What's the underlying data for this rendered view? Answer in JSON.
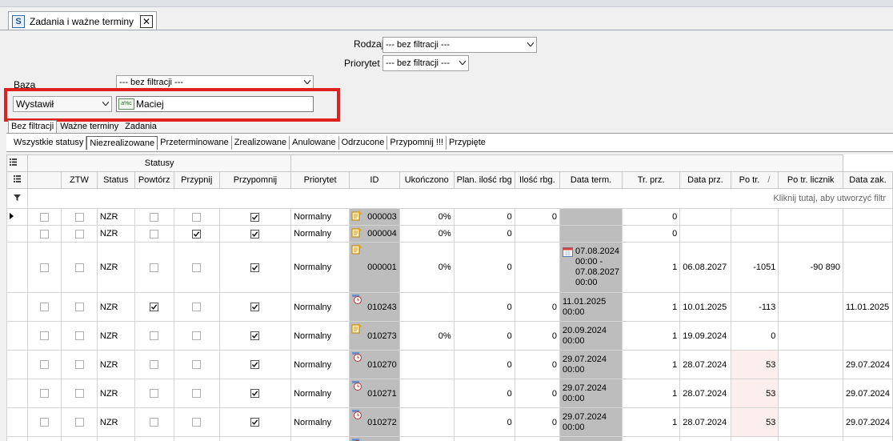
{
  "window": {
    "tab_title": "Zadania i ważne terminy",
    "close_label": "✕",
    "app_icon": "S"
  },
  "filters": {
    "rodzaj_label": "Rodzaj",
    "rodzaj_value": "--- bez filtracji ---",
    "priorytet_label": "Priorytet",
    "priorytet_value": "--- bez filtracji ---",
    "baza_label": "Baza",
    "baza_value": "--- bez filtracji ---",
    "field_select_value": "Wystawił",
    "field_input_icon": "a%c",
    "field_input_value": "Maciej"
  },
  "tabs_top": [
    "Bez filtracji",
    "Ważne terminy",
    "Zadania"
  ],
  "tabs_status": [
    "Wszystkie statusy",
    "Niezrealizowane",
    "Przeterminowane",
    "Zrealizowane",
    "Anulowane",
    "Odrzucone",
    "Przypomnij !!!",
    "Przypięte"
  ],
  "grid": {
    "group_label": "Statusy",
    "filter_hint": "Kliknij tutaj, aby utworzyć filtr",
    "sort_indicator": "/",
    "columns": [
      "ZTW",
      "Status",
      "Powtórz",
      "Przypnij",
      "Przypomnij",
      "Priorytet",
      "ID",
      "Ukończono",
      "Plan. ilość rbg",
      "Ilość rbg.",
      "Data term.",
      "Tr. prz.",
      "Data prz.",
      "Po tr.",
      "Po tr. licznik",
      "Data zak."
    ],
    "rows": [
      {
        "icon": "note",
        "selected": true,
        "ztw": false,
        "status": "NZR",
        "powtorz": false,
        "przypnij": false,
        "przypomnij": true,
        "priorytet": "Normalny",
        "id": "000003",
        "ukonczono": "0%",
        "plan": "0",
        "ilosc": "0",
        "data_term": "",
        "tr_prz": "0",
        "data_prz": "",
        "po_tr": "",
        "po_tr_licznik": "",
        "data_zak": "",
        "height": 20
      },
      {
        "icon": "note",
        "selected": false,
        "ztw": false,
        "status": "NZR",
        "powtorz": false,
        "przypnij": true,
        "przypomnij": true,
        "priorytet": "Normalny",
        "id": "000004",
        "ukonczono": "0%",
        "plan": "0",
        "ilosc": "",
        "data_term": "",
        "tr_prz": "0",
        "data_prz": "",
        "po_tr": "",
        "po_tr_licznik": "",
        "data_zak": "",
        "height": 20
      },
      {
        "icon": "note",
        "selected": false,
        "ztw": false,
        "status": "NZR",
        "powtorz": false,
        "przypnij": false,
        "przypomnij": true,
        "priorytet": "Normalny",
        "id": "000001",
        "ukonczono": "0%",
        "plan": "0",
        "ilosc": "",
        "data_term": "07.08.2024 00:00 - 07.08.2027 00:00",
        "term_icon": "calendar",
        "tr_prz": "1",
        "data_prz": "06.08.2027",
        "po_tr": "-1051",
        "po_tr_licznik": "-90 890",
        "data_zak": "",
        "height": 62
      },
      {
        "icon": "clock",
        "selected": false,
        "ztw": false,
        "status": "NZR",
        "powtorz": true,
        "przypnij": false,
        "przypomnij": true,
        "priorytet": "Normalny",
        "id": "010243",
        "ukonczono": "",
        "plan": "0",
        "ilosc": "0",
        "data_term": "11.01.2025 00:00",
        "tr_prz": "1",
        "data_prz": "10.01.2025",
        "po_tr": "-113",
        "po_tr_licznik": "",
        "data_zak": "11.01.2025",
        "height": 35
      },
      {
        "icon": "note",
        "selected": false,
        "ztw": false,
        "status": "NZR",
        "powtorz": false,
        "przypnij": false,
        "przypomnij": true,
        "priorytet": "Normalny",
        "id": "010273",
        "ukonczono": "0%",
        "plan": "0",
        "ilosc": "0",
        "data_term": "20.09.2024 00:00",
        "tr_prz": "1",
        "data_prz": "19.09.2024",
        "po_tr": "0",
        "po_tr_licznik": "",
        "data_zak": "",
        "height": 35
      },
      {
        "icon": "clock",
        "selected": false,
        "ztw": false,
        "status": "NZR",
        "powtorz": false,
        "przypnij": false,
        "przypomnij": true,
        "priorytet": "Normalny",
        "id": "010270",
        "ukonczono": "",
        "plan": "0",
        "ilosc": "0",
        "data_term": "29.07.2024 00:00",
        "tr_prz": "1",
        "data_prz": "28.07.2024",
        "po_tr": "53",
        "po_tr_licznik": "",
        "data_zak": "29.07.2024",
        "pink": true,
        "height": 35
      },
      {
        "icon": "clock",
        "selected": false,
        "ztw": false,
        "status": "NZR",
        "powtorz": false,
        "przypnij": false,
        "przypomnij": true,
        "priorytet": "Normalny",
        "id": "010271",
        "ukonczono": "",
        "plan": "0",
        "ilosc": "0",
        "data_term": "29.07.2024 00:00",
        "tr_prz": "1",
        "data_prz": "28.07.2024",
        "po_tr": "53",
        "po_tr_licznik": "",
        "data_zak": "29.07.2024",
        "pink": true,
        "height": 35
      },
      {
        "icon": "clock",
        "selected": false,
        "ztw": false,
        "status": "NZR",
        "powtorz": false,
        "przypnij": false,
        "przypomnij": true,
        "priorytet": "Normalny",
        "id": "010272",
        "ukonczono": "",
        "plan": "0",
        "ilosc": "0",
        "data_term": "29.07.2024 00:00",
        "tr_prz": "1",
        "data_prz": "28.07.2024",
        "po_tr": "53",
        "po_tr_licznik": "",
        "data_zak": "29.07.2024",
        "pink": true,
        "height": 35
      },
      {
        "icon": "clock",
        "selected": false,
        "ztw": false,
        "status": "",
        "powtorz": false,
        "przypnij": false,
        "przypomnij": false,
        "priorytet": "",
        "id": "",
        "ukonczono": "",
        "plan": "",
        "ilosc": "",
        "data_term": "",
        "tr_prz": "",
        "data_prz": "",
        "po_tr": "",
        "po_tr_licznik": "",
        "data_zak": "",
        "height": 20
      }
    ]
  },
  "colors": {
    "highlight_red": "#e0201c",
    "gray_cell": "#bdbdbd",
    "pink_cell": "#fdeeee"
  }
}
